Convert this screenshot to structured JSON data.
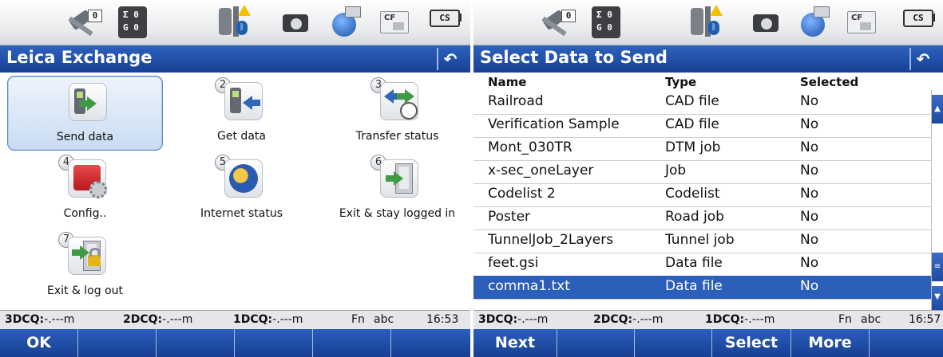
{
  "status": {
    "sat_count": "0",
    "sum_count": "Σ 0",
    "g_count": "G 0",
    "cf_label": "CF",
    "batt_label": "CS"
  },
  "left": {
    "title": "Leica Exchange",
    "tiles": [
      {
        "num": "",
        "label": "Send data",
        "icon": "send-data-icon"
      },
      {
        "num": "2",
        "label": "Get data",
        "icon": "get-data-icon"
      },
      {
        "num": "3",
        "label": "Transfer status",
        "icon": "transfer-status-icon"
      },
      {
        "num": "4",
        "label": "Config..",
        "icon": "config-icon"
      },
      {
        "num": "5",
        "label": "Internet status",
        "icon": "globe-icon"
      },
      {
        "num": "6",
        "label": "Exit & stay logged in",
        "icon": "exit-door-icon"
      },
      {
        "num": "7",
        "label": "Exit & log out",
        "icon": "logout-lock-icon"
      }
    ],
    "info": {
      "q3_label": "3DCQ:",
      "q3_val": "-.---m",
      "q2_label": "2DCQ:",
      "q2_val": "-.---m",
      "q1_label": "1DCQ:",
      "q1_val": "-.---m",
      "fn": "Fn",
      "mode": "abc",
      "time": "16:53"
    },
    "softkeys": [
      "OK",
      "",
      "",
      "",
      "",
      ""
    ]
  },
  "right": {
    "title": "Select Data to Send",
    "headers": {
      "name": "Name",
      "type": "Type",
      "selected": "Selected"
    },
    "rows": [
      {
        "name": "Railroad",
        "type": "CAD file",
        "selected": "No"
      },
      {
        "name": "Verification Sample",
        "type": "CAD file",
        "selected": "No"
      },
      {
        "name": "Mont_030TR",
        "type": "DTM job",
        "selected": "No"
      },
      {
        "name": "x-sec_oneLayer",
        "type": "Job",
        "selected": "No"
      },
      {
        "name": "Codelist 2",
        "type": "Codelist",
        "selected": "No"
      },
      {
        "name": "Poster",
        "type": "Road job",
        "selected": "No"
      },
      {
        "name": "TunnelJob_2Layers",
        "type": "Tunnel job",
        "selected": "No"
      },
      {
        "name": "feet.gsi",
        "type": "Data file",
        "selected": "No"
      },
      {
        "name": "comma1.txt",
        "type": "Data file",
        "selected": "No"
      }
    ],
    "info": {
      "q3_label": "3DCQ:",
      "q3_val": "-.---m",
      "q2_label": "2DCQ:",
      "q2_val": "-.---m",
      "q1_label": "1DCQ:",
      "q1_val": "-.---m",
      "fn": "Fn",
      "mode": "abc",
      "time": "16:57"
    },
    "softkeys": [
      "Next",
      "",
      "",
      "Select",
      "More",
      ""
    ]
  }
}
